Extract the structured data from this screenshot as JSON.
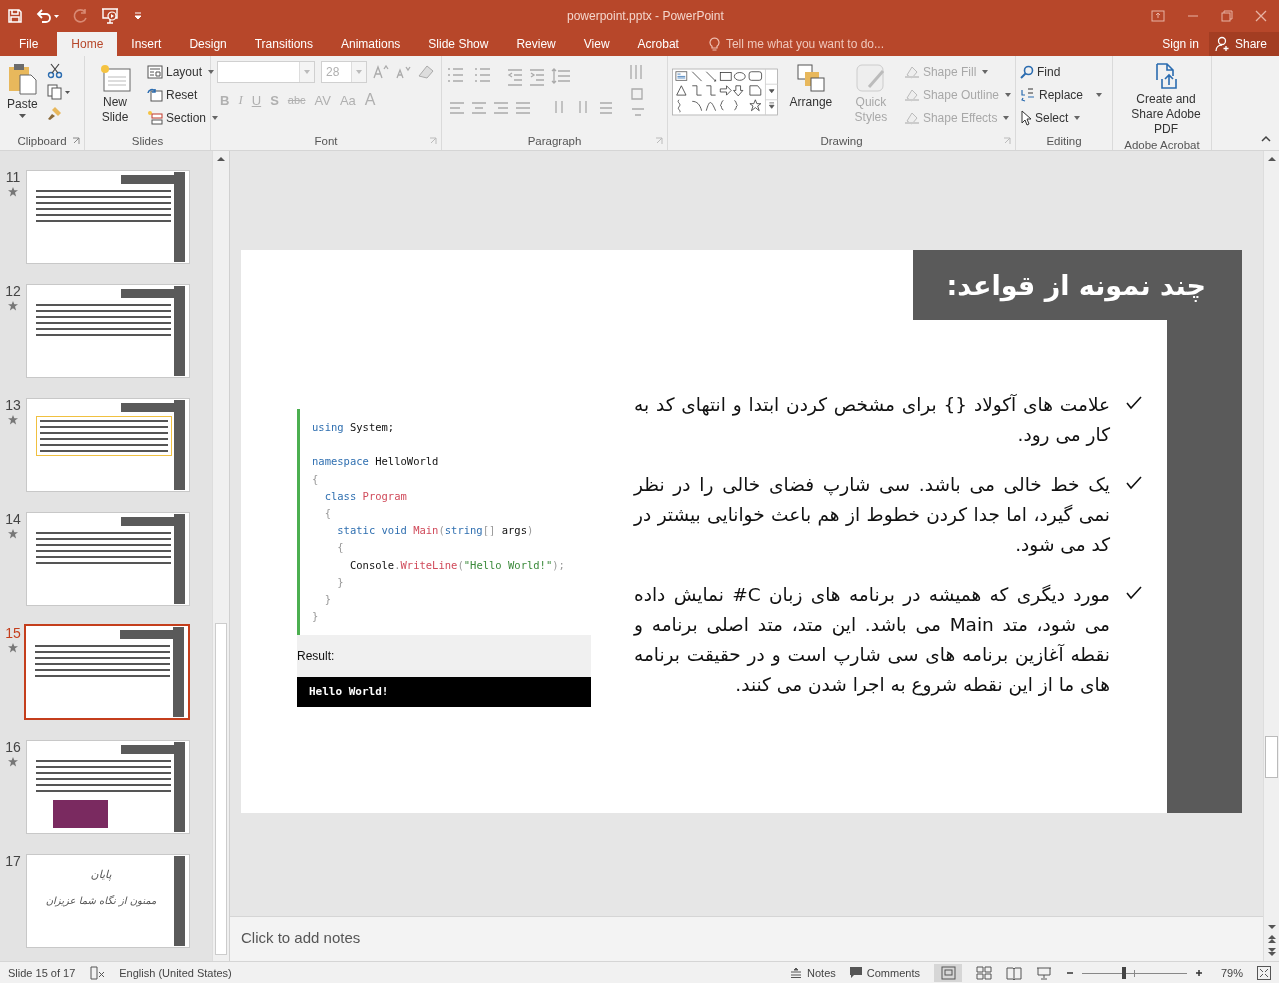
{
  "window": {
    "title": "powerpoint.pptx - PowerPoint"
  },
  "tabs": [
    {
      "label": "File",
      "selected": false
    },
    {
      "label": "Home",
      "selected": true
    },
    {
      "label": "Insert",
      "selected": false
    },
    {
      "label": "Design",
      "selected": false
    },
    {
      "label": "Transitions",
      "selected": false
    },
    {
      "label": "Animations",
      "selected": false
    },
    {
      "label": "Slide Show",
      "selected": false
    },
    {
      "label": "Review",
      "selected": false
    },
    {
      "label": "View",
      "selected": false
    },
    {
      "label": "Acrobat",
      "selected": false
    }
  ],
  "tell_me": {
    "placeholder": "Tell me what you want to do..."
  },
  "sign_in": "Sign in",
  "share": "Share",
  "ribbon": {
    "clipboard": {
      "label": "Clipboard",
      "paste": "Paste"
    },
    "slides": {
      "label": "Slides",
      "new_slide": "New Slide",
      "layout": "Layout",
      "reset": "Reset",
      "section": "Section"
    },
    "font": {
      "label": "Font",
      "size": "28",
      "disabled": true,
      "buttons": [
        "B",
        "I",
        "U",
        "S",
        "abc",
        "AV",
        "Aa",
        "A"
      ]
    },
    "paragraph": {
      "label": "Paragraph"
    },
    "drawing": {
      "label": "Drawing",
      "buttons": [
        {
          "label": "Arrange",
          "disabled": false
        },
        {
          "label": "Quick Styles",
          "disabled": true
        }
      ],
      "shape_buttons": [
        {
          "label": "Shape Fill",
          "disabled": true
        },
        {
          "label": "Shape Outline",
          "disabled": true
        },
        {
          "label": "Shape Effects",
          "disabled": true
        }
      ]
    },
    "editing": {
      "label": "Editing",
      "find": "Find",
      "replace": "Replace",
      "select": "Select"
    },
    "acrobat": {
      "label": "Adobe Acrobat",
      "button": "Create and Share Adobe PDF"
    }
  },
  "slides": [
    {
      "number": "11",
      "starred": true,
      "selected": false,
      "kind": "content"
    },
    {
      "number": "12",
      "starred": true,
      "selected": false,
      "kind": "content"
    },
    {
      "number": "13",
      "starred": true,
      "selected": false,
      "kind": "scroll"
    },
    {
      "number": "14",
      "starred": true,
      "selected": false,
      "kind": "content"
    },
    {
      "number": "15",
      "starred": true,
      "selected": true,
      "kind": "content"
    },
    {
      "number": "16",
      "starred": true,
      "selected": false,
      "kind": "picture"
    },
    {
      "number": "17",
      "starred": false,
      "selected": false,
      "kind": "closing",
      "title": "پایان",
      "subtitle": "ممنون از نگاه شما عزیزان"
    }
  ],
  "slide": {
    "title": "چند نمونه از قواعد:",
    "code": [
      {
        "kind": "code",
        "tokens": [
          {
            "text": "using",
            "kind": "keyword"
          },
          {
            "text": " System;",
            "kind": "plain"
          }
        ]
      },
      {
        "kind": "blank"
      },
      {
        "kind": "code",
        "tokens": [
          {
            "text": "namespace",
            "kind": "keyword"
          },
          {
            "text": " HelloWorld",
            "kind": "plain"
          }
        ]
      },
      {
        "kind": "code",
        "tokens": [
          {
            "text": "{",
            "kind": "punct"
          }
        ]
      },
      {
        "kind": "code",
        "tokens": [
          {
            "text": "  class",
            "kind": "keyword"
          },
          {
            "text": " Program",
            "kind": "type"
          }
        ]
      },
      {
        "kind": "code",
        "tokens": [
          {
            "text": "  {",
            "kind": "punct"
          }
        ]
      },
      {
        "kind": "code",
        "tokens": [
          {
            "text": "    static void",
            "kind": "keyword"
          },
          {
            "text": " Main",
            "kind": "type"
          },
          {
            "text": "(",
            "kind": "punct"
          },
          {
            "text": "string",
            "kind": "keyword"
          },
          {
            "text": "[] ",
            "kind": "punct"
          },
          {
            "text": "args",
            "kind": "plain"
          },
          {
            "text": ")",
            "kind": "punct"
          }
        ]
      },
      {
        "kind": "code",
        "tokens": [
          {
            "text": "    {",
            "kind": "punct"
          }
        ]
      },
      {
        "kind": "code",
        "tokens": [
          {
            "text": "      Console",
            "kind": "plain"
          },
          {
            "text": ".",
            "kind": "punct"
          },
          {
            "text": "WriteLine",
            "kind": "type"
          },
          {
            "text": "(",
            "kind": "punct"
          },
          {
            "text": "\"Hello World!\"",
            "kind": "string"
          },
          {
            "text": ");",
            "kind": "punct"
          }
        ]
      },
      {
        "kind": "code",
        "tokens": [
          {
            "text": "    }",
            "kind": "punct"
          }
        ]
      },
      {
        "kind": "code",
        "tokens": [
          {
            "text": "  }",
            "kind": "punct"
          }
        ]
      },
      {
        "kind": "code",
        "tokens": [
          {
            "text": "}",
            "kind": "punct"
          }
        ]
      }
    ],
    "result_label": "Result:",
    "output": "Hello World!",
    "bullets": [
      "علامت های آکولاد {} برای مشخص کردن ابتدا و انتهای کد به کار می رود.",
      "یک خط خالی می باشد. سی شارپ فضای خالی را در نظر نمی گیرد، اما جدا کردن خطوط از هم باعث خوانایی بیشتر در کد می شود.",
      "مورد دیگری که همیشه در برنامه های زبان C# نمایش داده می شود، متد Main می باشد. این متد، متد اصلی برنامه و نقطه آغازین برنامه های سی شارپ است و در حقیقت برنامه های ما از این نقطه شروع به اجرا شدن می کنند."
    ]
  },
  "notes": {
    "placeholder": "Click to add notes"
  },
  "status_bar": {
    "slide_info": "Slide 15 of 17",
    "language": "English (United States)",
    "notes": "Notes",
    "comments": "Comments",
    "zoom": "79%",
    "zoom_level": {
      "level": 0.4
    }
  }
}
